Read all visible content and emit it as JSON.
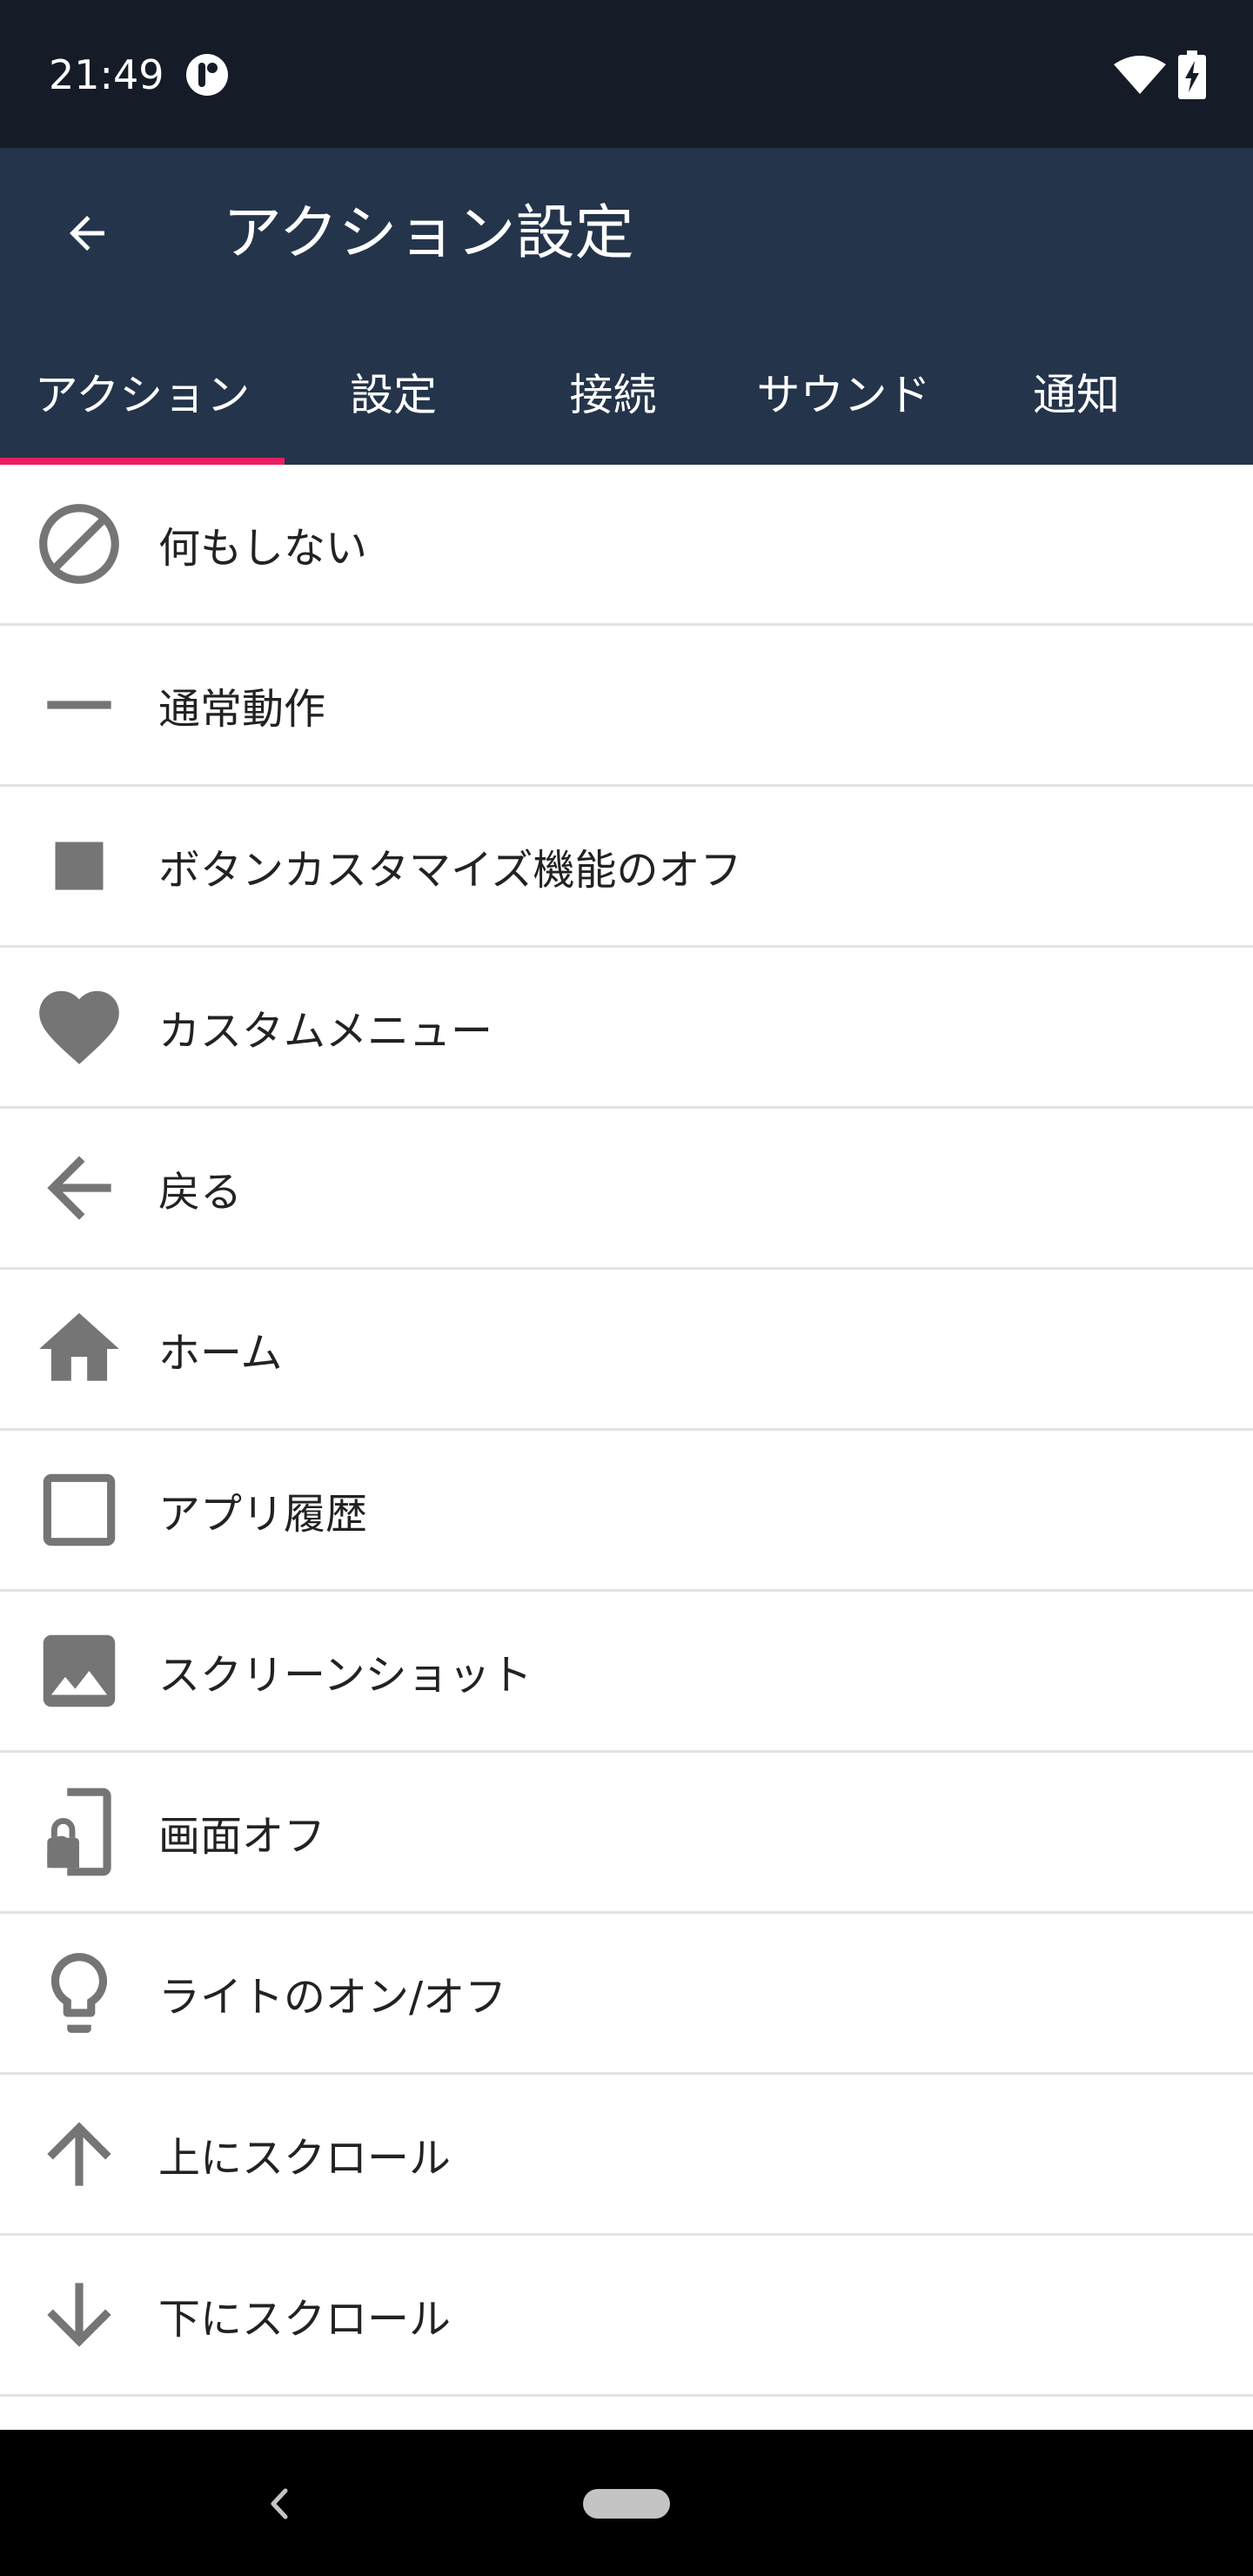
{
  "status_bar": {
    "time": "21:49",
    "icons": [
      "app-notification-icon",
      "wifi-icon",
      "battery-charging-icon"
    ]
  },
  "app_bar": {
    "title": "アクション設定",
    "back_icon": "arrow-back-icon"
  },
  "tabs": [
    {
      "label": "アクション",
      "selected": true
    },
    {
      "label": "設定",
      "selected": false
    },
    {
      "label": "接続",
      "selected": false
    },
    {
      "label": "サウンド",
      "selected": false
    },
    {
      "label": "通知",
      "selected": false
    }
  ],
  "actions": [
    {
      "label": "何もしない",
      "icon": "block-icon"
    },
    {
      "label": "通常動作",
      "icon": "minus-icon"
    },
    {
      "label": "ボタンカスタマイズ機能のオフ",
      "icon": "stop-square-icon"
    },
    {
      "label": "カスタムメニュー",
      "icon": "heart-icon"
    },
    {
      "label": "戻る",
      "icon": "arrow-back-icon"
    },
    {
      "label": "ホーム",
      "icon": "home-icon"
    },
    {
      "label": "アプリ履歴",
      "icon": "square-outline-icon"
    },
    {
      "label": "スクリーンショット",
      "icon": "image-icon"
    },
    {
      "label": "画面オフ",
      "icon": "phone-lock-icon"
    },
    {
      "label": "ライトのオン/オフ",
      "icon": "lightbulb-icon"
    },
    {
      "label": "上にスクロール",
      "icon": "arrow-up-icon"
    },
    {
      "label": "下にスクロール",
      "icon": "arrow-down-icon"
    }
  ],
  "colors": {
    "status_bar": "#151c27",
    "app_bar": "#24344a",
    "tab_indicator": "#e91e63",
    "icon": "#757575"
  }
}
